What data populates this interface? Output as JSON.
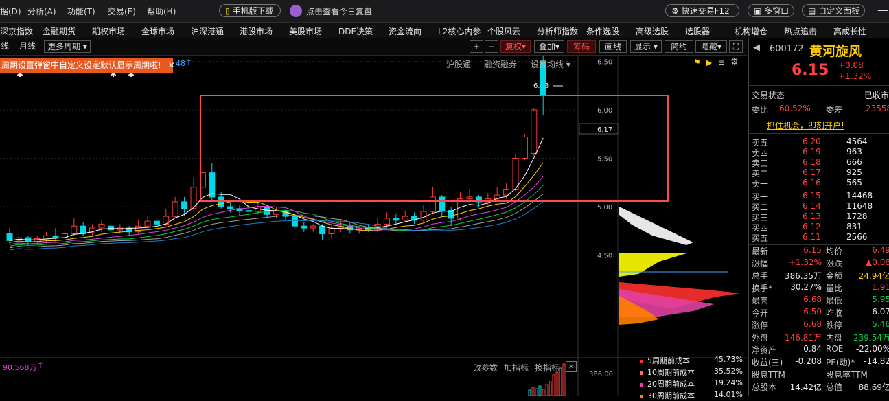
{
  "menu": {
    "items": [
      "据(D)",
      "分析(A)",
      "功能(T)",
      "交易(E)",
      "帮助(H)"
    ],
    "mobile_download": "手机版下载",
    "replay": "点击查看今日复盘",
    "quick_trade": "快速交易F12",
    "multi_window": "多窗口",
    "custom_panel": "自定义面板"
  },
  "nav": {
    "items": [
      "深京指数",
      "金融期货",
      "期权市场",
      "全球市场",
      "沪深港通",
      "港股市场",
      "美股市场",
      "DDE决策",
      "资金流向",
      "L2核心内参",
      "个股风云",
      "分析师指数",
      "条件选股",
      "高级选股",
      "选股器",
      "机构增仓",
      "热点追击",
      "高成长性"
    ]
  },
  "toolbar": {
    "left_partial": "线",
    "month": "月线",
    "more_period": "更多周期",
    "plus": "+",
    "minus": "−",
    "fuquan": "复权",
    "overlay": "叠加",
    "chips": "筹码",
    "draw": "画线",
    "display": "显示",
    "simple": "简约",
    "hide": "隐藏"
  },
  "chart": {
    "notice": "周期设置弹窗中自定义设定默认显示周期啦!",
    "notice_tail": "48",
    "hgt": "沪股通",
    "margin": "融资融券",
    "set_ma": "设置均线",
    "high_label": "6.68",
    "current_tag": "6.17",
    "price_ticks": [
      "6.50",
      "6.00",
      "5.50",
      "5.00",
      "4.50"
    ],
    "vol_label": "90.568万",
    "vol_tick": "386.00",
    "params": "改参数",
    "add_indicator": "加指标",
    "switch_indicator": "换指标",
    "close": "×",
    "cost_legend": [
      {
        "label": "5周期前成本",
        "pct": "45.73%",
        "color": "#ff3030"
      },
      {
        "label": "10周期前成本",
        "pct": "35.52%",
        "color": "#ff7070"
      },
      {
        "label": "20周期前成本",
        "pct": "19.24%",
        "color": "#e040a0"
      },
      {
        "label": "30周期前成本",
        "pct": "14.01%",
        "color": "#ff8000"
      }
    ]
  },
  "stock": {
    "code": "600172",
    "name": "黄河旋风",
    "price": "6.15",
    "change": "+0.08",
    "change_pct": "+1.32%",
    "status_label": "交易状态",
    "status": "已收市",
    "weibi_label": "委比",
    "weibi": "60.52%",
    "weicha_label": "委差",
    "weicha": "23558",
    "promo": "抓住机会，即刻开户!",
    "asks": [
      {
        "label": "卖五",
        "price": "6.20",
        "vol": "4564"
      },
      {
        "label": "卖四",
        "price": "6.19",
        "vol": "963"
      },
      {
        "label": "卖三",
        "price": "6.18",
        "vol": "666"
      },
      {
        "label": "卖二",
        "price": "6.17",
        "vol": "925"
      },
      {
        "label": "卖一",
        "price": "6.16",
        "vol": "565"
      }
    ],
    "bids": [
      {
        "label": "买一",
        "price": "6.15",
        "vol": "14468"
      },
      {
        "label": "买二",
        "price": "6.14",
        "vol": "11648"
      },
      {
        "label": "买三",
        "price": "6.13",
        "vol": "1728"
      },
      {
        "label": "买四",
        "price": "6.12",
        "vol": "831"
      },
      {
        "label": "买五",
        "price": "6.11",
        "vol": "2566"
      }
    ],
    "stats": [
      {
        "l1": "最新",
        "v1": "6.15",
        "c1": "red",
        "l2": "均价",
        "v2": "6.49",
        "c2": "red"
      },
      {
        "l1": "涨幅",
        "v1": "+1.32%",
        "c1": "red",
        "l2": "涨跌",
        "v2": "▲0.08",
        "c2": "red"
      },
      {
        "l1": "总手",
        "v1": "386.35万",
        "c1": "white",
        "l2": "金额",
        "v2": "24.94亿",
        "c2": "yellow"
      },
      {
        "l1": "换手*",
        "v1": "30.27%",
        "c1": "white",
        "l2": "量比",
        "v2": "1.91",
        "c2": "red"
      },
      {
        "l1": "最高",
        "v1": "6.68",
        "c1": "red",
        "l2": "最低",
        "v2": "5.95",
        "c2": "green"
      },
      {
        "l1": "今开",
        "v1": "6.50",
        "c1": "red",
        "l2": "昨收",
        "v2": "6.07",
        "c2": "white"
      },
      {
        "l1": "涨停",
        "v1": "6.68",
        "c1": "red",
        "l2": "跌停",
        "v2": "5.46",
        "c2": "green"
      },
      {
        "l1": "外盘",
        "v1": "146.81万",
        "c1": "red",
        "l2": "内盘",
        "v2": "239.54万",
        "c2": "green"
      },
      {
        "l1": "净资产",
        "v1": "0.84",
        "c1": "white",
        "l2": "ROE",
        "v2": "-22.00%",
        "c2": "white"
      },
      {
        "l1": "收益(三)",
        "v1": "-0.208",
        "c1": "white",
        "l2": "PE(动)*",
        "v2": "-14.82",
        "c2": "white"
      },
      {
        "l1": "股息TTM",
        "v1": "—",
        "c1": "white",
        "l2": "股息率TTM",
        "v2": "—",
        "c2": "white"
      },
      {
        "l1": "总股本",
        "v1": "14.42亿",
        "c1": "white",
        "l2": "总值",
        "v2": "88.69亿",
        "c2": "white"
      }
    ]
  }
}
